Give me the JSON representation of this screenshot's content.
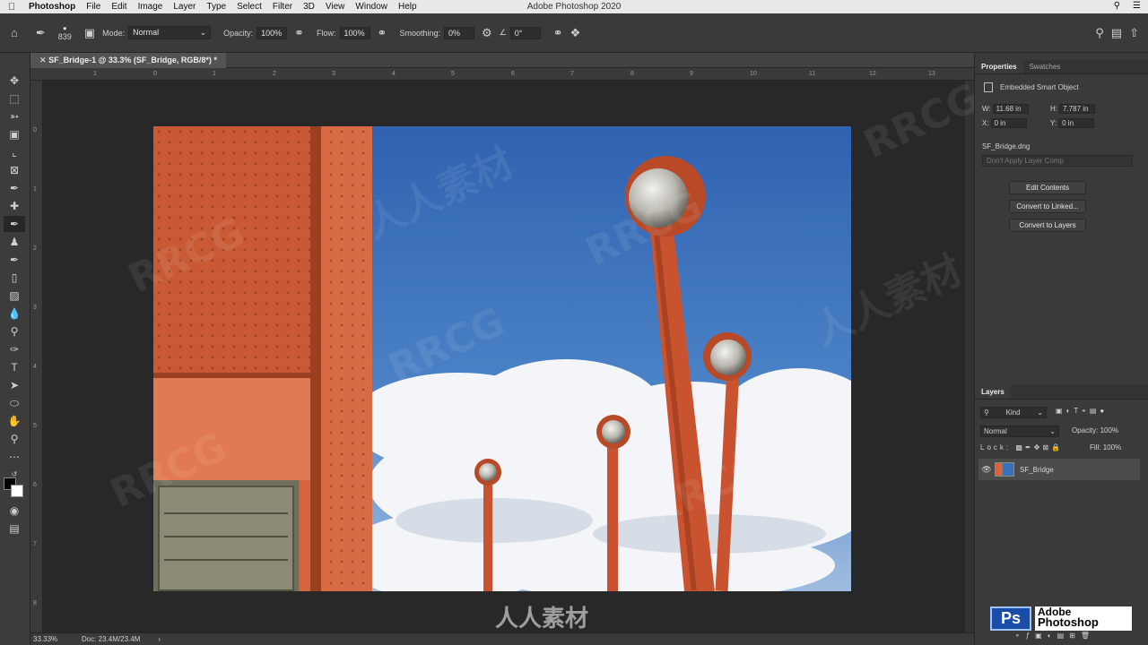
{
  "menubar": {
    "app": "Photoshop",
    "items": [
      "File",
      "Edit",
      "Image",
      "Layer",
      "Type",
      "Select",
      "Filter",
      "3D",
      "View",
      "Window",
      "Help"
    ],
    "window_title": "Adobe Photoshop 2020"
  },
  "options": {
    "brush_size": "839",
    "mode_label": "Mode:",
    "mode_value": "Normal",
    "opacity_label": "Opacity:",
    "opacity_value": "100%",
    "flow_label": "Flow:",
    "flow_value": "100%",
    "smoothing_label": "Smoothing:",
    "smoothing_value": "0%",
    "angle_value": "0°"
  },
  "document": {
    "tab_title": "SF_Bridge-1 @ 33.3% (SF_Bridge, RGB/8*) *"
  },
  "ruler": {
    "h_ticks": [
      "1",
      "0",
      "1",
      "2",
      "3",
      "4",
      "5",
      "6",
      "7",
      "8",
      "9",
      "10",
      "11",
      "12",
      "13"
    ],
    "v_ticks": [
      "0",
      "1",
      "2",
      "3",
      "4",
      "5",
      "6",
      "7",
      "8"
    ]
  },
  "status": {
    "zoom": "33.33%",
    "doc": "Doc: 23.4M/23.4M"
  },
  "properties": {
    "tab_properties": "Properties",
    "tab_swatches": "Swatches",
    "object_type": "Embedded Smart Object",
    "w_label": "W:",
    "w_value": "11.68 in",
    "h_label": "H:",
    "h_value": "7.787 in",
    "x_label": "X:",
    "x_value": "0 in",
    "y_label": "Y:",
    "y_value": "0 in",
    "filename": "SF_Bridge.dng",
    "layer_comp_placeholder": "Don't Apply Layer Comp",
    "btn_edit": "Edit Contents",
    "btn_convert_linked": "Convert to Linked...",
    "btn_convert_layers": "Convert to Layers"
  },
  "layers": {
    "tab": "Layers",
    "filter_kind": "Kind",
    "blend_mode": "Normal",
    "opacity_label": "Opacity:",
    "opacity_value": "100%",
    "lock_label": "Lock:",
    "fill_label": "Fill:",
    "fill_value": "100%",
    "items": [
      {
        "name": "SF_Bridge"
      }
    ]
  },
  "branding": {
    "ps_badge": "Ps",
    "ps_line1": "Adobe",
    "ps_line2": "Photoshop",
    "watermark": [
      "RRCG",
      "人人素材"
    ]
  },
  "colors": {
    "ui_dark": "#3a3a3a",
    "canvas_bg": "#282828",
    "sky": "#3a70b8",
    "bridge_orange": "#d2613a",
    "ps_blue": "#1a4da8"
  }
}
